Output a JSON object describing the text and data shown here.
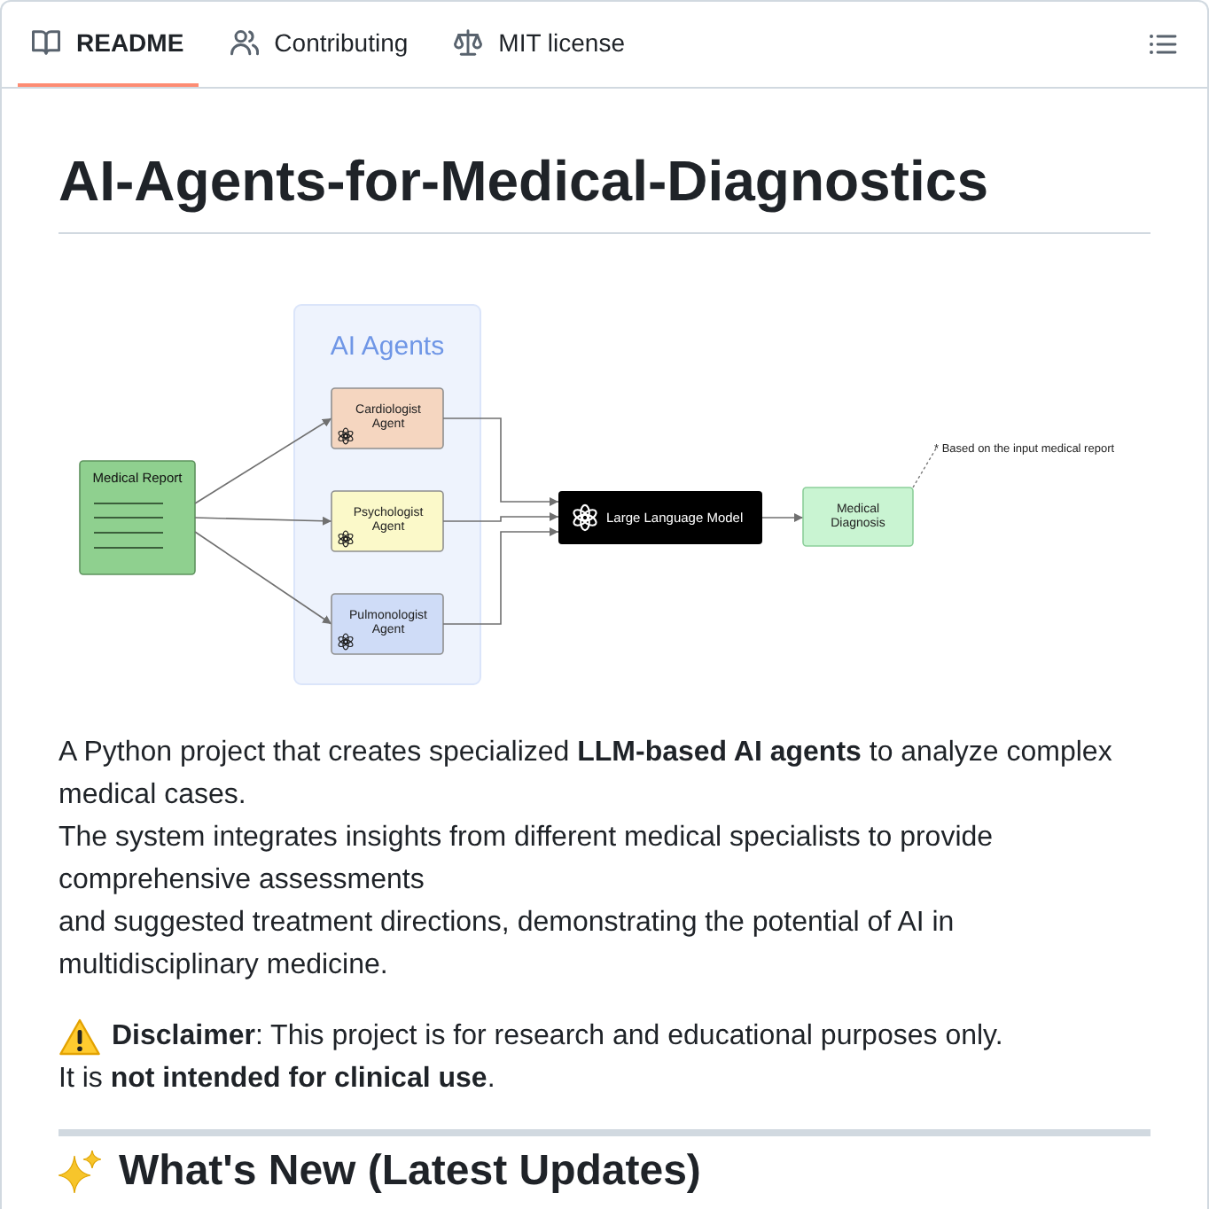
{
  "tabs": [
    {
      "label": "README",
      "selected": true
    },
    {
      "label": "Contributing",
      "selected": false
    },
    {
      "label": "MIT license",
      "selected": false
    }
  ],
  "readme": {
    "title": "AI-Agents-for-Medical-Diagnostics",
    "diagram": {
      "input": {
        "title": "Medical Report"
      },
      "group_title": "AI Agents",
      "agents": [
        {
          "lines": [
            "Cardiologist",
            "Agent"
          ],
          "color": "#f5d6c0"
        },
        {
          "lines": [
            "Psychologist",
            "Agent"
          ],
          "color": "#fbf9c9"
        },
        {
          "lines": [
            "Pulmonologist",
            "Agent"
          ],
          "color": "#cfdcf7"
        }
      ],
      "model": {
        "label": "Large Language Model"
      },
      "output": {
        "lines": [
          "Medical",
          "Diagnosis"
        ]
      },
      "note": "* Based on the input medical report"
    },
    "intro": [
      "A Python project that creates specialized **LLM-based AI agents** to analyze complex medical cases.",
      "The system integrates insights from different medical specialists to provide comprehensive assessments",
      "and suggested treatment directions, demonstrating the potential of AI in multidisciplinary medicine."
    ],
    "disclaimer": [
      "**Disclaimer**: This project is for research and educational purposes only.",
      "It is **not intended for clinical use**."
    ],
    "next_heading": "What's New (Latest Updates)"
  }
}
